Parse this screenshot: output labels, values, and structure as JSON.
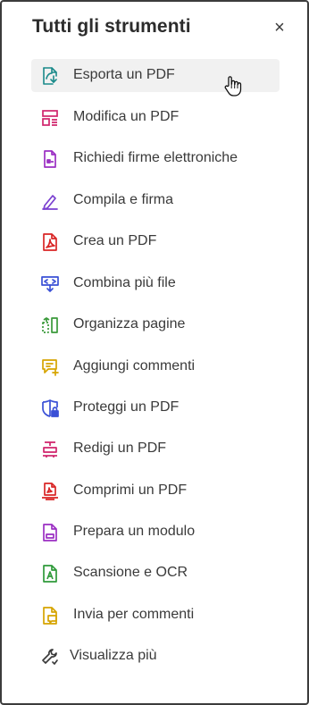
{
  "panel": {
    "title": "Tutti gli strumenti",
    "close_glyph": "×"
  },
  "tools": [
    {
      "label": "Esporta un PDF",
      "icon": "export-pdf-icon",
      "color": "#1a8a8a"
    },
    {
      "label": "Modifica un PDF",
      "icon": "edit-pdf-icon",
      "color": "#d0246c"
    },
    {
      "label": "Richiedi firme elettroniche",
      "icon": "request-signatures-icon",
      "color": "#9b2fc3"
    },
    {
      "label": "Compila e firma",
      "icon": "fill-sign-icon",
      "color": "#7a3fd0"
    },
    {
      "label": "Crea un PDF",
      "icon": "create-pdf-icon",
      "color": "#d92626"
    },
    {
      "label": "Combina più file",
      "icon": "combine-files-icon",
      "color": "#3a50d6"
    },
    {
      "label": "Organizza pagine",
      "icon": "organize-pages-icon",
      "color": "#3a9a3a"
    },
    {
      "label": "Aggiungi commenti",
      "icon": "add-comments-icon",
      "color": "#d6a400"
    },
    {
      "label": "Proteggi un PDF",
      "icon": "protect-pdf-icon",
      "color": "#3a50d6"
    },
    {
      "label": "Redigi un PDF",
      "icon": "redact-pdf-icon",
      "color": "#d0246c"
    },
    {
      "label": "Comprimi un PDF",
      "icon": "compress-pdf-icon",
      "color": "#d92626"
    },
    {
      "label": "Prepara un modulo",
      "icon": "prepare-form-icon",
      "color": "#9b2fc3"
    },
    {
      "label": "Scansione e OCR",
      "icon": "scan-ocr-icon",
      "color": "#2f9a3a"
    },
    {
      "label": "Invia per commenti",
      "icon": "send-comments-icon",
      "color": "#d6a400"
    }
  ],
  "more": {
    "label": "Visualizza più",
    "icon": "wrench-icon",
    "color": "#3a3a3a"
  }
}
